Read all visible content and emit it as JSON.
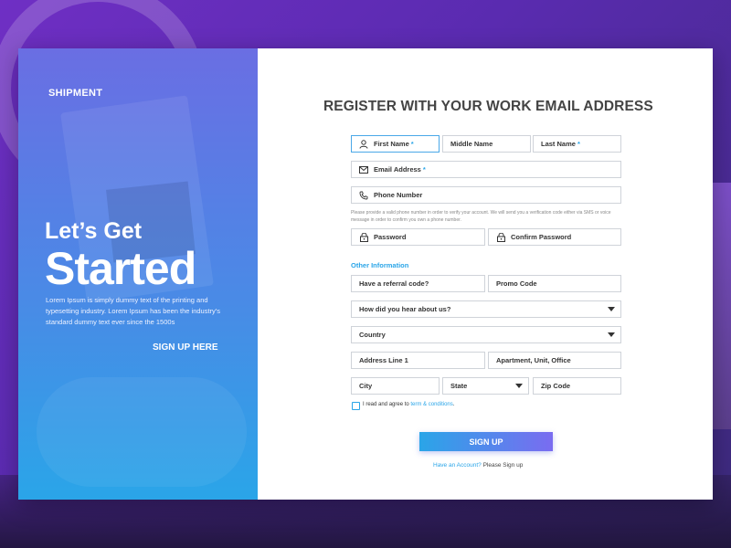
{
  "brand": "SHIPMENT",
  "hero": {
    "lets": "Let’s Get",
    "started": "Started",
    "lorem": "Lorem Ipsum is simply dummy text of the printing and typesetting industry. Lorem Ipsum has been the industry's standard dummy text ever since the 1500s",
    "signup_here": "SIGN UP HERE"
  },
  "form": {
    "title": "REGISTER WITH YOUR WORK EMAIL ADDRESS",
    "first_name": "First Name",
    "middle_name": "Middle Name",
    "last_name": "Last Name",
    "email": "Email Address",
    "phone": "Phone Number",
    "required_mark": "*",
    "phone_note": "Please provide a valid phone number in order to verify your account. We will send you a verification code either via SMS or voice message in order to confirm you own a phone number.",
    "password": "Password",
    "confirm_password": "Confirm Password",
    "other_info": "Other Information",
    "referral": "Have a referral code?",
    "promo": "Promo Code",
    "hear_about": "How did you hear about us?",
    "country": "Country",
    "address1": "Address Line 1",
    "apartment": "Apartment, Unit, Office",
    "city": "City",
    "state": "State",
    "zip": "Zip Code",
    "agree_text": "I read and agree to",
    "agree_link": "term & conditions",
    "agree_end": ".",
    "signup_button": "SIGN UP",
    "have_account_link": "Have an Account?",
    "have_account_text": "Please Sign up"
  },
  "colors": {
    "accent": "#2aa5e8",
    "purple": "#7a6cf0"
  },
  "icons": {
    "first_name": "user-icon",
    "email": "envelope-icon",
    "phone": "phone-icon",
    "password": "lock-icon"
  }
}
